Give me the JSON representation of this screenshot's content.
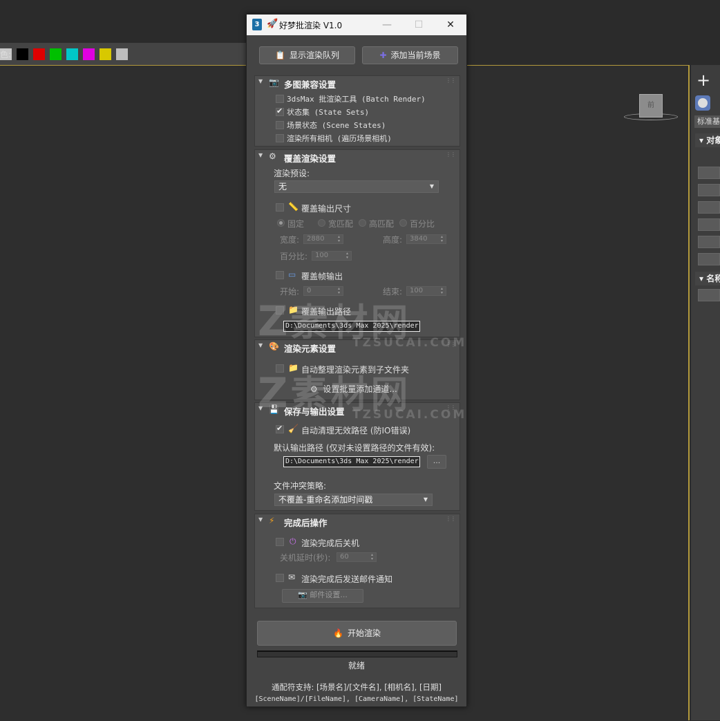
{
  "background": {
    "color_label": "色:",
    "swatches": [
      "#c8c8c8",
      "#000000",
      "#e00000",
      "#00c000",
      "#00c8c8",
      "#e000e0",
      "#d8c800",
      "#bdbdbd"
    ],
    "viewcube_label": "前",
    "cmd_dropdown": "标准基",
    "cmd_section1": "对象",
    "cmd_section2": "名称"
  },
  "dialog": {
    "title": "好梦批渲染 V1.0",
    "app_icon": "3",
    "toolbar": {
      "show_queue": "显示渲染队列",
      "add_scene": "添加当前场景"
    },
    "multi": {
      "title": "多图兼容设置",
      "items": [
        {
          "label": "3dsMax 批渲染工具 (Batch Render)",
          "checked": false
        },
        {
          "label": "状态集 (State Sets)",
          "checked": true
        },
        {
          "label": "场景状态 (Scene States)",
          "checked": false
        },
        {
          "label": "渲染所有相机 (遍历场景相机)",
          "checked": false
        }
      ]
    },
    "override": {
      "title": "覆盖渲染设置",
      "preset_label": "渲染预设:",
      "preset_value": "无",
      "size_label": "覆盖输出尺寸",
      "radios": [
        "固定",
        "宽匹配",
        "高匹配",
        "百分比"
      ],
      "width_label": "宽度:",
      "width_value": "2880",
      "height_label": "高度:",
      "height_value": "3840",
      "percent_label": "百分比:",
      "percent_value": "100",
      "frame_label": "覆盖帧输出",
      "start_label": "开始:",
      "start_value": "0",
      "end_label": "结束:",
      "end_value": "100",
      "path_label": "覆盖输出路径",
      "path_value": "D:\\Documents\\3ds Max 2025\\render"
    },
    "elements": {
      "title": "渲染元素设置",
      "auto_label": "自动整理渲染元素到子文件夹",
      "batch_button": "设置批量添加通道..."
    },
    "save": {
      "title": "保存与输出设置",
      "clean_label": "自动清理无效路径 (防IO错误)",
      "default_label": "默认输出路径 (仅对未设置路径的文件有效):",
      "default_path": "D:\\Documents\\3ds Max 2025\\render",
      "browse": "...",
      "conflict_label": "文件冲突策略:",
      "conflict_value": "不覆盖-重命名添加时间戳"
    },
    "finish": {
      "title": "完成后操作",
      "shutdown_label": "渲染完成后关机",
      "delay_label": "关机延时(秒):",
      "delay_value": "60",
      "email_label": "渲染完成后发送邮件通知",
      "email_button": "邮件设置..."
    },
    "start_button": "开始渲染",
    "status": "就绪",
    "hint1": "通配符支持: [场景名]/[文件名], [相机名], [日期]",
    "hint2": "[SceneName]/[FileName], [CameraName], [StateName]"
  },
  "watermark": {
    "text": "素材网",
    "sub": "TZSUCAI.COM"
  }
}
